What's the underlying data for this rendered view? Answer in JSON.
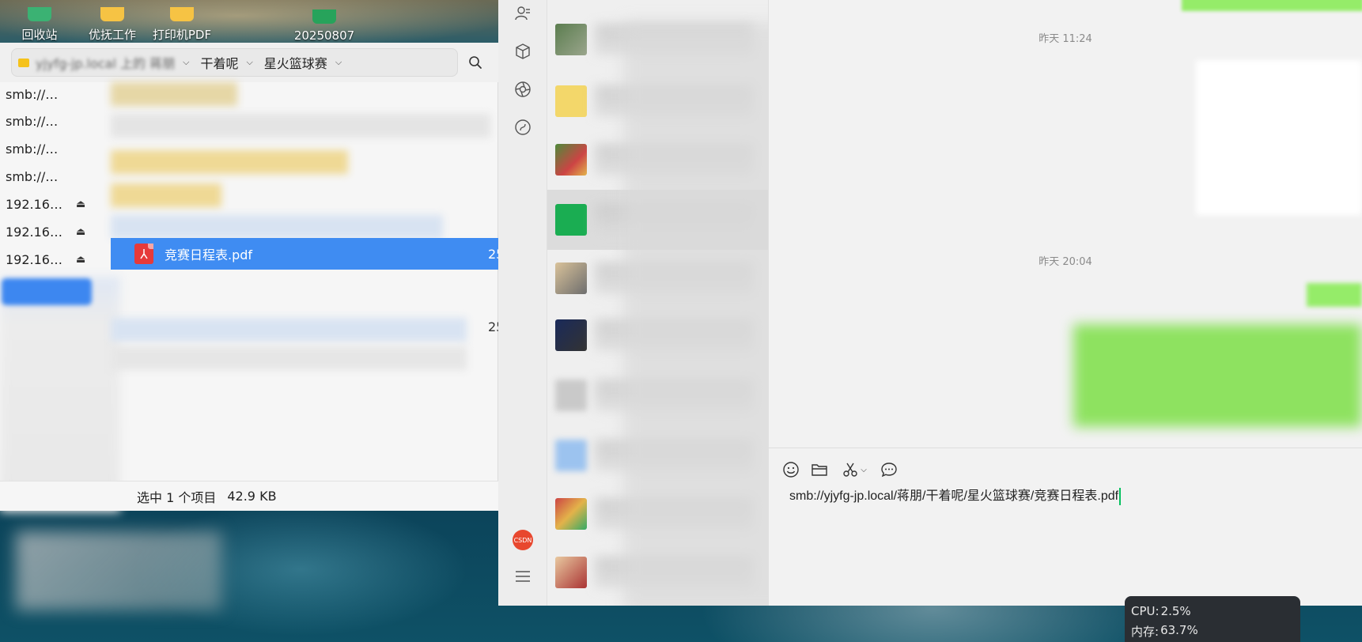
{
  "desktop": {
    "icons": [
      {
        "label": "回收站",
        "color": "#3bb273"
      },
      {
        "label": "优抚工作",
        "color": "#f6c344"
      },
      {
        "label": "打印机PDF",
        "color": "#f6c344"
      },
      {
        "label": "20250807",
        "color": "#27a35b"
      }
    ]
  },
  "file_manager": {
    "breadcrumbs": [
      {
        "label": "yjyfg-jp.local 上的 蒋朋"
      },
      {
        "label": "干着呢"
      },
      {
        "label": "星火篮球赛"
      }
    ],
    "sidebar": [
      {
        "label": "smb://…",
        "ejectable": false
      },
      {
        "label": "smb://…",
        "ejectable": false
      },
      {
        "label": "smb://…",
        "ejectable": false
      },
      {
        "label": "smb://…",
        "ejectable": false
      },
      {
        "label": "192.16…",
        "ejectable": true
      },
      {
        "label": "192.16…",
        "ejectable": true
      },
      {
        "label": "192.16…",
        "ejectable": true
      }
    ],
    "selected_file": {
      "name": "竞赛日程表.pdf",
      "size": "25"
    },
    "other_file_size": "25",
    "status": {
      "selection": "选中 1 个项目",
      "size": "42.9 KB"
    },
    "accent_color": "#3f8cf2"
  },
  "chat": {
    "timestamps": [
      "昨天 11:24",
      "昨天 20:04"
    ],
    "composer_text": "smb://yjyfg-jp.local/蒋朋/干着呢/星火篮球赛/竞赛日程表.pdf",
    "rail_avatar_text": "CSDN",
    "tools": [
      "emoji-icon",
      "folder-icon",
      "scissors-icon",
      "chat-bubble-icon"
    ],
    "bubble_color": "#95ec69"
  },
  "system_monitor": {
    "cpu_label": "CPU:",
    "cpu_value": "2.5%",
    "mem_label": "内存:",
    "mem_value": "63.7%"
  }
}
